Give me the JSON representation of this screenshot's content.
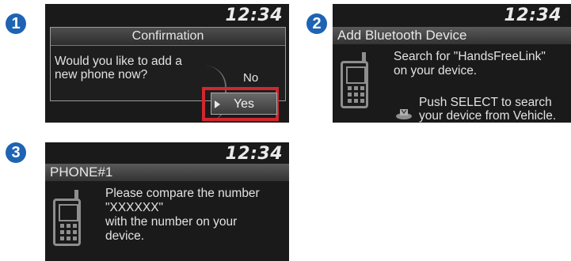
{
  "steps": [
    "1",
    "2",
    "3"
  ],
  "screen1": {
    "clock": "12:34",
    "title": "Confirmation",
    "question_line1": "Would you like to add a",
    "question_line2": "new phone now?",
    "option_no": "No",
    "option_yes": "Yes"
  },
  "screen2": {
    "clock": "12:34",
    "header": "Add Bluetooth Device",
    "search_line1": "Search for \"HandsFreeLink\"",
    "search_line2": "on your device.",
    "push_line1": "Push SELECT to search",
    "push_line2": "your device from Vehicle."
  },
  "screen3": {
    "clock": "12:34",
    "header": "PHONE#1",
    "line1": "Please compare the number",
    "line2": "\"XXXXXX\"",
    "line3": "with the number on your",
    "line4": "device."
  },
  "icons": [
    "phone-icon",
    "select-knob-icon"
  ],
  "colors": {
    "badge": "#1f63b3",
    "highlight": "#d3262f",
    "screen_bg": "#1a1a1a"
  }
}
